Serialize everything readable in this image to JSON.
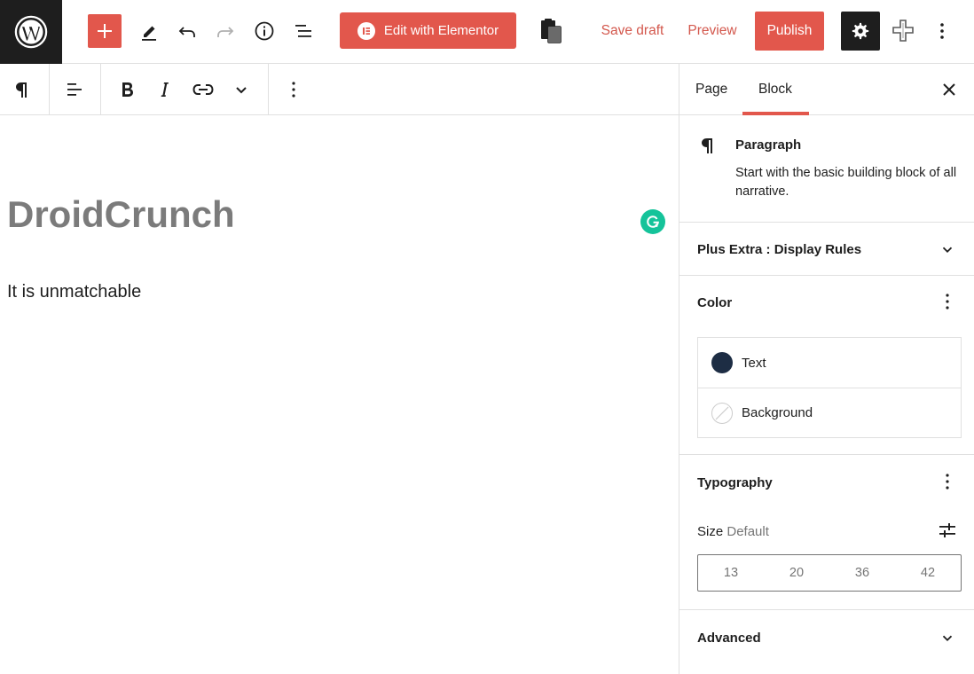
{
  "topbar": {
    "elementor_label": "Edit with Elementor",
    "save_draft_label": "Save draft",
    "preview_label": "Preview",
    "publish_label": "Publish"
  },
  "editor": {
    "title": "DroidCrunch",
    "paragraph": "It is unmatchable"
  },
  "sidebar": {
    "tabs": [
      {
        "label": "Page"
      },
      {
        "label": "Block",
        "active": true
      }
    ],
    "block": {
      "name": "Paragraph",
      "description": "Start with the basic building block of all narrative."
    },
    "panels": {
      "display_rules": "Plus Extra : Display Rules",
      "color": "Color",
      "typography": "Typography",
      "advanced": "Advanced"
    },
    "colors": [
      {
        "label": "Text",
        "swatch": "#1d2d44"
      },
      {
        "label": "Background",
        "swatch": "none"
      }
    ],
    "size": {
      "label": "Size",
      "value": "Default",
      "options": [
        "13",
        "20",
        "36",
        "42"
      ]
    }
  },
  "theme": {
    "accent": "#e2574c",
    "dark": "#1e1e1e",
    "grammarly": "#15c39a"
  }
}
